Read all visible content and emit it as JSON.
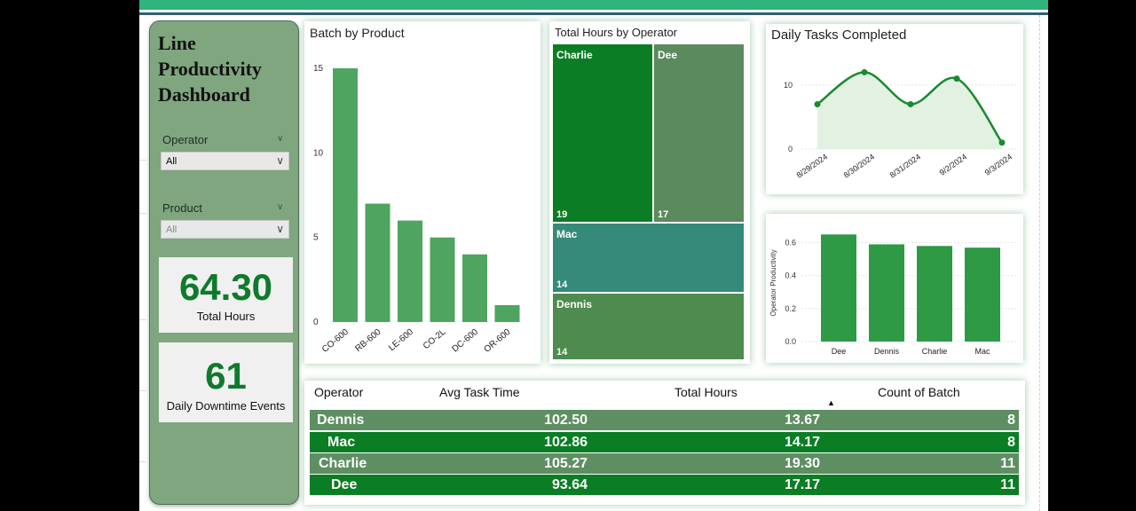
{
  "dashboard": {
    "title": "Line Productivity Dashboard",
    "colors": {
      "sidebar": "#7fa67f",
      "accent": "#0e7a2b",
      "topbar": "#2fb47c"
    }
  },
  "filters": {
    "operator": {
      "label": "Operator",
      "value": "All"
    },
    "product": {
      "label": "Product",
      "value": "All"
    }
  },
  "kpis": {
    "total_hours": {
      "value": "64.30",
      "label": "Total Hours"
    },
    "downtime": {
      "value": "61",
      "label": "Daily Downtime Events"
    }
  },
  "chart_data": [
    {
      "id": "batch_by_product",
      "type": "bar",
      "title": "Batch by Product",
      "categories": [
        "CO-600",
        "RB-600",
        "LE-600",
        "CO-2L",
        "DC-600",
        "OR-600"
      ],
      "values": [
        15,
        7,
        6,
        5,
        4,
        1
      ],
      "ylim": [
        0,
        15
      ],
      "yticks": [
        "0",
        "5",
        "10",
        "15"
      ],
      "color": "#4ea55f",
      "grid": false
    },
    {
      "id": "total_hours_by_operator",
      "type": "treemap",
      "title": "Total Hours by Operator",
      "items": [
        {
          "name": "Charlie",
          "value": 19,
          "label": "19",
          "color": "#0b7d24"
        },
        {
          "name": "Dee",
          "value": 17,
          "label": "17",
          "color": "#5b8a5e"
        },
        {
          "name": "Mac",
          "value": 14,
          "label": "14",
          "color": "#358a7a"
        },
        {
          "name": "Dennis",
          "value": 14,
          "label": "14",
          "color": "#4e8b4e"
        }
      ]
    },
    {
      "id": "daily_tasks_completed",
      "type": "area",
      "title": "Daily Tasks Completed",
      "categories": [
        "8/29/2024",
        "8/30/2024",
        "8/31/2024",
        "9/2/2024",
        "9/3/2024"
      ],
      "values": [
        7,
        12,
        7,
        11,
        1
      ],
      "ylim": [
        0,
        14
      ],
      "yticks": [
        "0",
        "10"
      ],
      "color": "#1a8a2e",
      "grid": true
    },
    {
      "id": "operator_productivity",
      "type": "bar",
      "title": "",
      "ylabel": "Operator Productivity",
      "categories": [
        "Dee",
        "Dennis",
        "Charlie",
        "Mac"
      ],
      "values": [
        0.65,
        0.59,
        0.58,
        0.57
      ],
      "ylim": [
        0,
        0.7
      ],
      "yticks": [
        "0.0",
        "0.2",
        "0.4",
        "0.6"
      ],
      "color": "#2e9a45",
      "grid": true
    },
    {
      "id": "operator_table",
      "type": "table",
      "headers": {
        "operator": "Operator",
        "avg_task_time": "Avg Task Time",
        "total_hours": "Total Hours",
        "count_batch": "Count of Batch"
      },
      "rows": [
        {
          "operator": "Dennis",
          "avg_task_time": "102.50",
          "total_hours": "13.67",
          "count_batch": "8"
        },
        {
          "operator": "Mac",
          "avg_task_time": "102.86",
          "total_hours": "14.17",
          "count_batch": "8"
        },
        {
          "operator": "Charlie",
          "avg_task_time": "105.27",
          "total_hours": "19.30",
          "count_batch": "11"
        },
        {
          "operator": "Dee",
          "avg_task_time": "93.64",
          "total_hours": "17.17",
          "count_batch": "11"
        }
      ],
      "row_colors": [
        "#5e8f62",
        "#0b7d24",
        "#5e8f62",
        "#0b7d24"
      ],
      "sorted_column": "total_hours"
    }
  ]
}
